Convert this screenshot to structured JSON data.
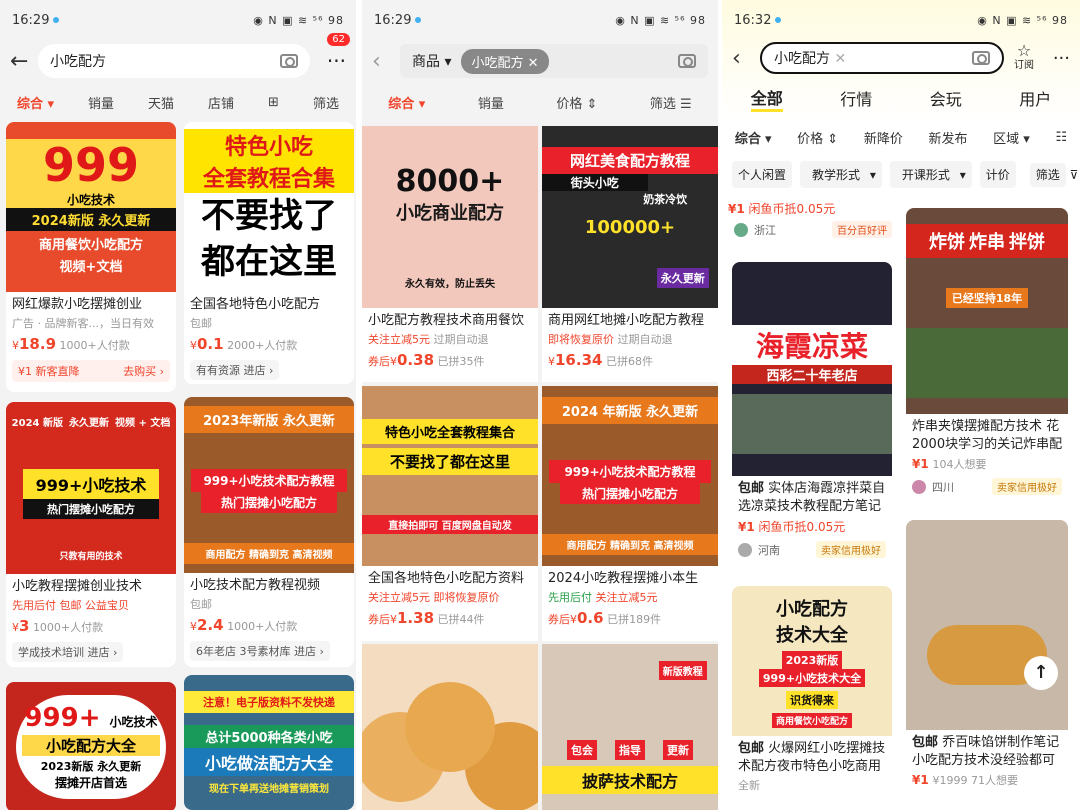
{
  "s1": {
    "time": "16:29",
    "status_icons": "◉ N ▣ ≋ ⁵⁶ 98",
    "query": "小吃配方",
    "badge": "62",
    "filters": [
      "综合",
      "销量",
      "天猫",
      "店铺",
      "筛选"
    ],
    "cards": [
      {
        "img": [
          "999",
          "小吃技术",
          "2024新版 永久更新",
          "商用餐饮小吃配方",
          "视频+文档"
        ],
        "title": "网红爆款小吃摆摊创业",
        "meta": "广告 · 品牌新客...，当日有效",
        "price_sym": "¥",
        "price": "18.9",
        "sold": "1000+人付款",
        "coupon_l": "¥1 新客直降",
        "coupon_r": "去购买 ›"
      },
      {
        "img": [
          "特色小吃",
          "全套教程合集",
          "不要找了",
          "都在这里"
        ],
        "title": "全国各地特色小吃配方",
        "meta": "包邮",
        "price_sym": "¥",
        "price": "0.1",
        "sold": "2000+人付款",
        "shop": "有有资源 进店 ›"
      },
      {
        "img": [
          "2024 新版",
          "永久更新",
          "视频 + 文档",
          "999+小吃技术",
          "热门摆摊小吃配方",
          "只教有用的技术"
        ],
        "title": "小吃教程摆摊创业技术",
        "meta": "先用后付 包邮 公益宝贝",
        "price_sym": "¥",
        "price": "3",
        "sold": "1000+人付款",
        "shop": "学成技术培训 进店 ›"
      },
      {
        "img": [
          "2023年新版 永久更新",
          "999+小吃技术配方教程",
          "热门摆摊小吃配方",
          "商用配方 精确到克 高清视频"
        ],
        "title": "小吃技术配方教程视频",
        "meta": "包邮",
        "price_sym": "¥",
        "price": "2.4",
        "sold": "1000+人付款",
        "shop": "6年老店 3号素材库 进店 ›"
      },
      {
        "img": [
          "999+",
          "小吃技术",
          "小吃配方大全",
          "2023新版 永久更新",
          "摆摊开店首选"
        ]
      },
      {
        "img": [
          "注意！电子版资料不发快递",
          "总计5000种各类小吃",
          "小吃做法配方大全",
          "现在下单再送地摊营销策划"
        ]
      }
    ]
  },
  "s2": {
    "time": "16:29",
    "status_icons": "◉ N ▣ ≋ ⁵⁶ 98",
    "scope": "商品",
    "query": "小吃配方",
    "filters": [
      "综合",
      "销量",
      "价格",
      "筛选"
    ],
    "cards": [
      {
        "img": [
          "8000+",
          "小吃商业配方",
          "永久有效，防止丢失"
        ],
        "title": "小吃配方教程技术商用餐饮",
        "meta_a": "关注立减5元",
        "meta_b": "过期自动退",
        "price_pre": "券后",
        "price_sym": "¥",
        "price": "0.38",
        "sold": "已拼35件"
      },
      {
        "img": [
          "网红美食配方教程",
          "街头小吃",
          "奶茶冷饮",
          "100000+",
          "永久更新"
        ],
        "title": "商用网红地摊小吃配方教程",
        "meta_a": "即将恢复原价",
        "meta_b": "过期自动退",
        "price_sym": "¥",
        "price": "16.34",
        "sold": "已拼68件"
      },
      {
        "img": [
          "特色小吃全套教程集合",
          "不要找了都在这里",
          "直接拍即可 百度网盘自动发"
        ],
        "title": "全国各地特色小吃配方资料",
        "meta_a": "关注立减5元",
        "meta_b": "即将恢复原价",
        "price_pre": "券后",
        "price_sym": "¥",
        "price": "1.38",
        "sold": "已拼44件"
      },
      {
        "img": [
          "2024 年新版 永久更新",
          "999+小吃技术配方教程",
          "热门摆摊小吃配方",
          "商用配方 精确到克 高清视频"
        ],
        "title": "2024小吃教程摆摊小本生",
        "meta_a": "先用后付",
        "meta_b": "关注立减5元",
        "price_pre": "券后",
        "price_sym": "¥",
        "price": "0.6",
        "sold": "已拼189件"
      },
      {
        "img": [
          ""
        ]
      },
      {
        "img": [
          "新版教程",
          "包会",
          "指导",
          "更新",
          "披萨技术配方"
        ]
      }
    ]
  },
  "s3": {
    "time": "16:32",
    "status_icons": "◉ N ▣ ≋ ⁵⁶ 98",
    "query": "小吃配方",
    "subscribe": "订阅",
    "tabs": [
      "全部",
      "行情",
      "会玩",
      "用户"
    ],
    "sorts": [
      "综合",
      "价格",
      "新降价",
      "新发布",
      "区域"
    ],
    "chips": [
      "个人闲置",
      "教学形式",
      "开课形式",
      "计价",
      "筛选"
    ],
    "top_left": {
      "price": "¥1",
      "note": "闲鱼币抵0.05元",
      "loc": "浙江",
      "tag": "百分百好评"
    },
    "cards": [
      {
        "img": [
          "海霞凉菜",
          "西彩二十年老店"
        ],
        "baoyou": "包邮",
        "title": "实体店海霞凉拌菜自",
        "title2": "选凉菜技术教程配方笔记",
        "price": "¥1",
        "note": "闲鱼币抵0.05元",
        "loc": "河南",
        "tag": "卖家信用极好"
      },
      {
        "img": [
          "炸饼",
          "炸串",
          "拌饼",
          "已经坚持18年"
        ],
        "title": "炸串夹馍摆摊配方技术 花",
        "title2": "2000块学习的关记炸串配",
        "price": "¥1",
        "note": "104人想要",
        "loc": "四川",
        "tag": "卖家信用极好"
      },
      {
        "img": [
          "小吃配方",
          "技术大全",
          "2023新版",
          "999+小吃技术大全",
          "识货得来",
          "商用餐饮小吃配方"
        ],
        "baoyou": "包邮",
        "title": "火爆网红小吃摆摊技",
        "title2": "术配方夜市特色小吃商用",
        "loc": "全新"
      },
      {
        "img": [
          ""
        ],
        "baoyou": "包邮",
        "title": "乔百味馅饼制作笔记",
        "title2": "小吃配方技术没经验都可",
        "price": "¥1",
        "note": "¥1999 71人想要"
      }
    ]
  }
}
